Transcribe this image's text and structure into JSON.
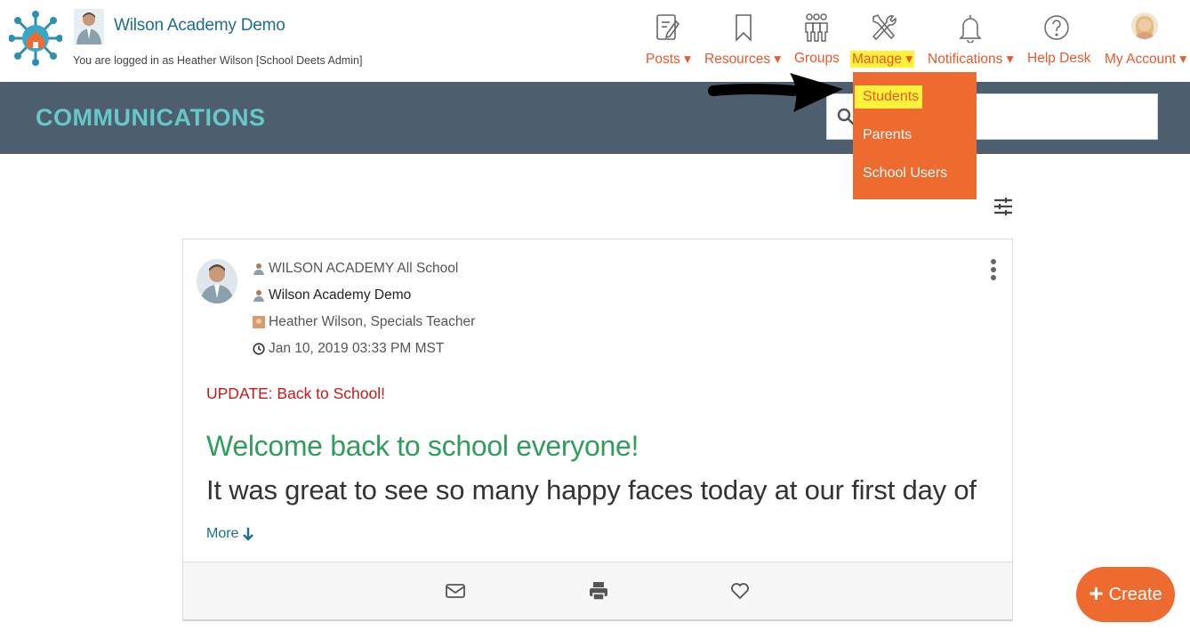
{
  "header": {
    "school_name": "Wilson Academy Demo",
    "logged_in_text": "You are logged in as Heather Wilson [School Deets Admin]"
  },
  "nav": [
    {
      "label": "Posts ▾",
      "icon": "edit-post-icon"
    },
    {
      "label": "Resources ▾",
      "icon": "bookmark-icon"
    },
    {
      "label": "Groups",
      "icon": "group-icon"
    },
    {
      "label": "Manage ▾",
      "icon": "tools-icon"
    },
    {
      "label": "Notifications ▾",
      "icon": "bell-icon"
    },
    {
      "label": "Help Desk",
      "icon": "help-icon"
    },
    {
      "label": "My Account ▾",
      "icon": "avatar"
    }
  ],
  "banner": {
    "title": "COMMUNICATIONS"
  },
  "manage_dropdown": {
    "items": [
      "Students",
      "Parents",
      "School Users"
    ],
    "active": "Students"
  },
  "post": {
    "group": "WILSON ACADEMY All School",
    "school": "Wilson Academy Demo",
    "author": "Heather Wilson, Specials Teacher",
    "timestamp": "Jan 10, 2019 03:33 PM MST",
    "subject": "UPDATE: Back to School!",
    "heading": "Welcome back to school everyone!",
    "body_preview": "It was great to see so many happy faces today at our first day of",
    "more_label": "More"
  },
  "create_button": {
    "label": "Create"
  },
  "colors": {
    "accent": "#ee6b30",
    "banner": "#4d5e6e",
    "banner_title": "#66c9c9",
    "highlight": "#fff23a",
    "link": "#1c6f8e"
  }
}
